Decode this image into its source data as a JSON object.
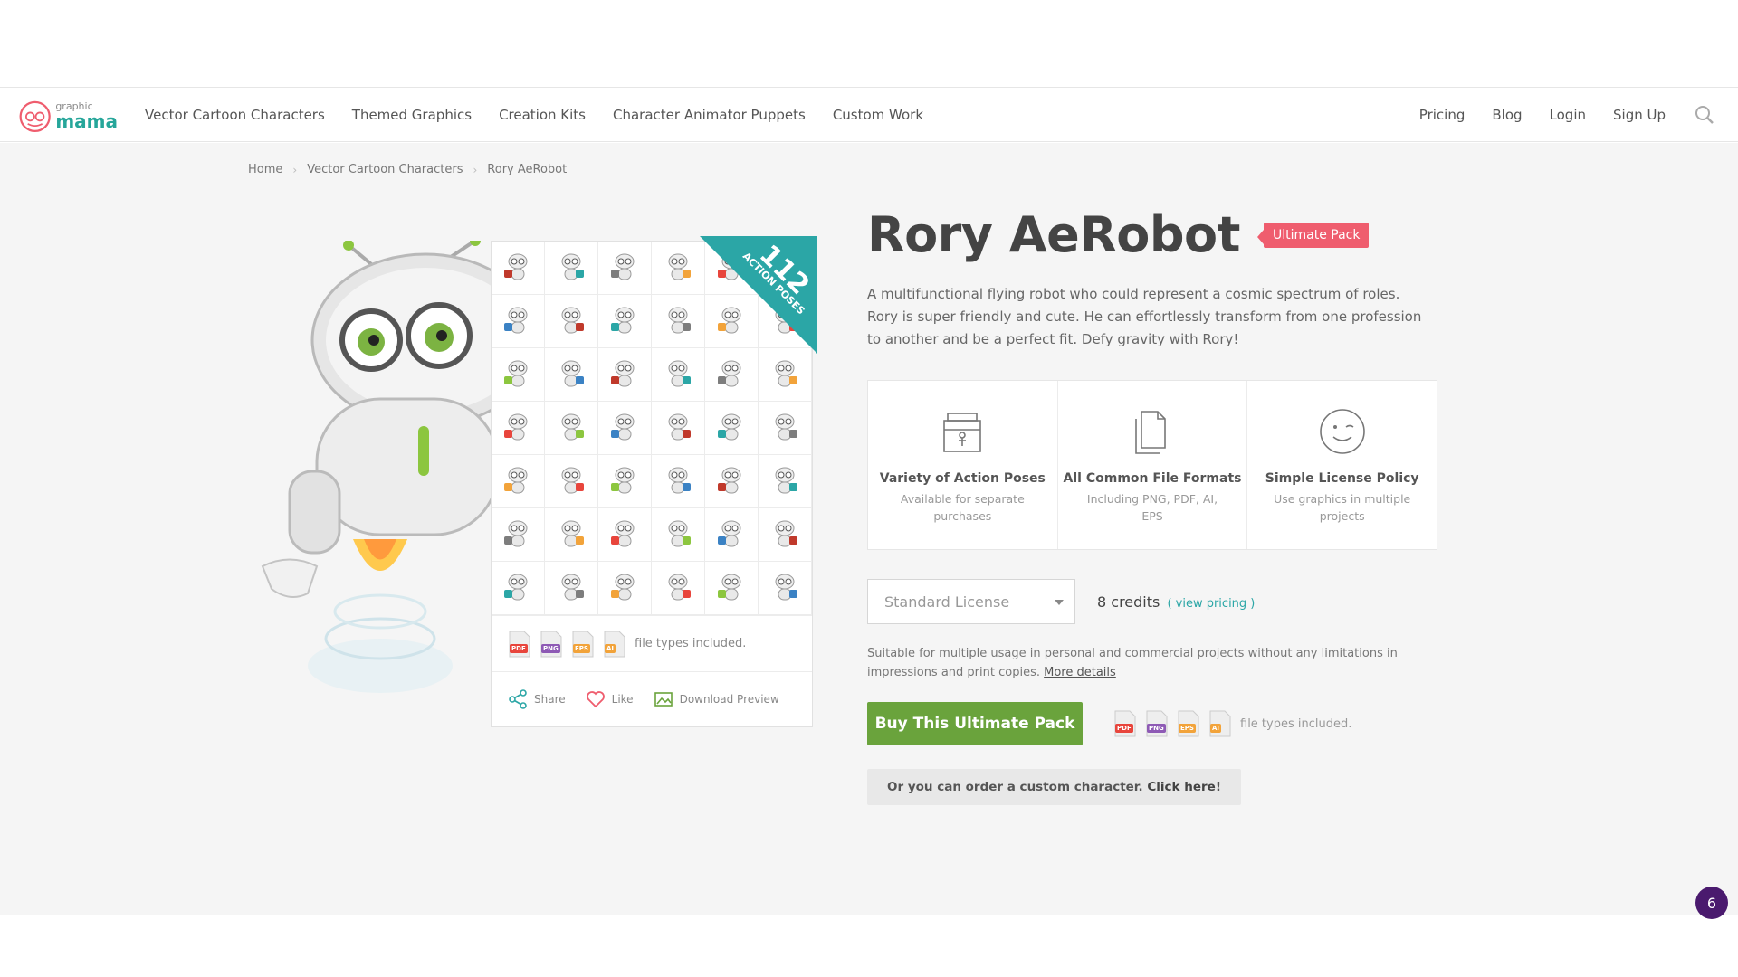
{
  "logo": {
    "small": "graphic",
    "big": "mama"
  },
  "nav": {
    "left": [
      "Vector Cartoon Characters",
      "Themed Graphics",
      "Creation Kits",
      "Character Animator Puppets",
      "Custom Work"
    ],
    "right": [
      "Pricing",
      "Blog",
      "Login",
      "Sign Up"
    ]
  },
  "breadcrumb": [
    "Home",
    "Vector Cartoon Characters",
    "Rory AeRobot"
  ],
  "ribbon": {
    "number": "112",
    "label": "ACTION POSES"
  },
  "preview": {
    "file_types_text": "file types included.",
    "share": "Share",
    "like": "Like",
    "download": "Download Preview"
  },
  "file_types": [
    {
      "label": "PDF",
      "color": "#e8453c"
    },
    {
      "label": "PNG",
      "color": "#8e5ab5"
    },
    {
      "label": "EPS",
      "color": "#f2a33a"
    },
    {
      "label": "AI",
      "color": "#f2a33a"
    }
  ],
  "product": {
    "title": "Rory AeRobot",
    "badge": "Ultimate Pack",
    "description": "A multifunctional flying robot who could represent a cosmic spectrum of roles. Rory is super friendly and cute. He can effortlessly transform from one profession to another and be a perfect fit. Defy gravity with Rory!"
  },
  "features": [
    {
      "title": "Variety of Action Poses",
      "sub": "Available for separate purchases"
    },
    {
      "title": "All Common File Formats",
      "sub": "Including PNG, PDF, AI, EPS"
    },
    {
      "title": "Simple License Policy",
      "sub": "Use graphics in multiple projects"
    }
  ],
  "license": {
    "selected": "Standard License",
    "credits": "8 credits",
    "view_pricing": "( view pricing )",
    "usage": "Suitable for multiple usage in personal and commercial projects without any limitations in impressions and print copies.",
    "more_details": "More details"
  },
  "buy": {
    "button": "Buy This Ultimate Pack",
    "file_types_text": "file types included."
  },
  "custom": {
    "text": "Or you can order a custom character.",
    "link": "Click here",
    "end": "!"
  },
  "chat_count": "6",
  "colors": {
    "accent": "#2ba6a6",
    "badge": "#ef5d6e",
    "buy": "#6aa33c"
  }
}
